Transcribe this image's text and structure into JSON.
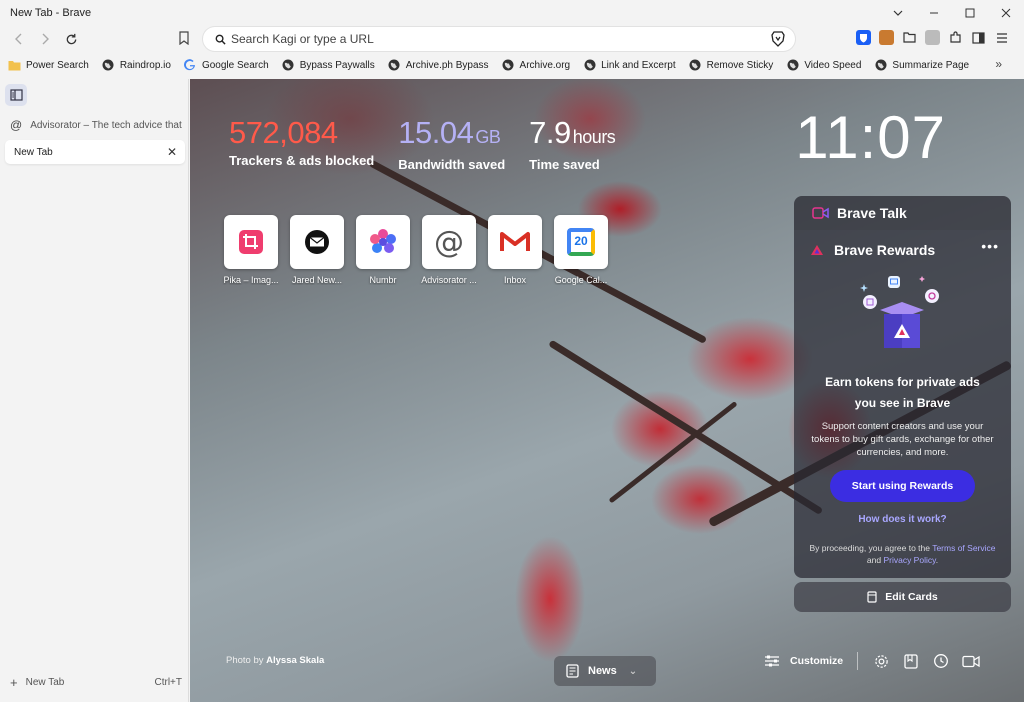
{
  "window": {
    "title": "New Tab - Brave"
  },
  "toolbar": {
    "search_placeholder": "Search Kagi or type a URL"
  },
  "bookmarks": [
    {
      "label": "Power Search",
      "icon": "folder-icon"
    },
    {
      "label": "Raindrop.io",
      "icon": "globe-icon"
    },
    {
      "label": "Google Search",
      "icon": "google-icon"
    },
    {
      "label": "Bypass Paywalls",
      "icon": "globe-icon"
    },
    {
      "label": "Archive.ph Bypass",
      "icon": "globe-icon"
    },
    {
      "label": "Archive.org",
      "icon": "globe-icon"
    },
    {
      "label": "Link and Excerpt",
      "icon": "globe-icon"
    },
    {
      "label": "Remove Sticky",
      "icon": "globe-icon"
    },
    {
      "label": "Video Speed",
      "icon": "globe-icon"
    },
    {
      "label": "Summarize Page",
      "icon": "globe-icon"
    }
  ],
  "sidebar": {
    "tabs": [
      {
        "label": "Advisorator – The tech advice that m",
        "active": false
      },
      {
        "label": "New Tab",
        "active": true
      }
    ],
    "new_tab_label": "New Tab",
    "new_tab_shortcut": "Ctrl+T"
  },
  "stats": {
    "trackers": {
      "value": "572,084",
      "label": "Trackers & ads blocked",
      "color": "#ff5a4a"
    },
    "bandwidth": {
      "value": "15.04",
      "unit": "GB",
      "label": "Bandwidth saved",
      "color": "#b5b1f5"
    },
    "time": {
      "value": "7.9",
      "unit": "hours",
      "label": "Time saved",
      "color": "#ffffff"
    }
  },
  "clock": "11:07",
  "top_sites": [
    {
      "label": "Pika – Imag...",
      "icon": "pika-icon"
    },
    {
      "label": "Jared New...",
      "icon": "mail-icon"
    },
    {
      "label": "Numbr",
      "icon": "numbr-icon"
    },
    {
      "label": "Advisorator ...",
      "icon": "at-icon"
    },
    {
      "label": "Inbox",
      "icon": "gmail-icon"
    },
    {
      "label": "Google Cal...",
      "icon": "calendar-icon",
      "day": "20"
    }
  ],
  "brave_talk": {
    "title": "Brave Talk"
  },
  "rewards": {
    "title": "Brave Rewards",
    "headline_line1": "Earn tokens for private ads",
    "headline_line2": "you see in Brave",
    "description": "Support content creators and use your tokens to buy gift cards, exchange for other currencies, and more.",
    "cta": "Start using Rewards",
    "how": "How does it work?",
    "legal_prefix": "By proceeding, you agree to the",
    "terms": "Terms of Service",
    "legal_and": "and",
    "privacy": "Privacy Policy",
    "legal_suffix": ".",
    "accent": "#3b2de2"
  },
  "edit_cards": "Edit Cards",
  "photo_credit": {
    "prefix": "Photo by",
    "author": "Alyssa Skala"
  },
  "news": "News",
  "customize": "Customize"
}
